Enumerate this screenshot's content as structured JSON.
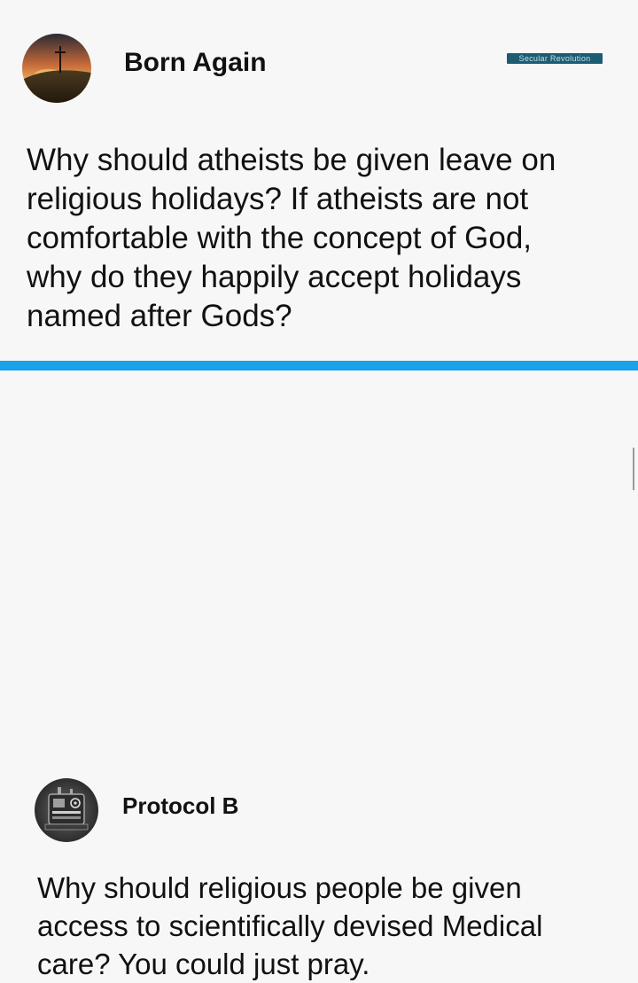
{
  "watermark": {
    "text": "Secular Revolution"
  },
  "colors": {
    "divider": "#1aa3e8",
    "background": "#f7f7f7",
    "watermark_bg": "#1d5b72"
  },
  "posts": [
    {
      "author": "Born Again",
      "avatar": "sunset-cross-on-hill-icon",
      "lines": [
        "Why should atheists be given leave on",
        "religious holidays? If atheists are not",
        "comfortable with the concept of God,",
        "why do they happily accept holidays",
        "named after Gods?"
      ]
    },
    {
      "author": "Protocol B",
      "avatar": "machine-icon",
      "lines": [
        "Why should religious people be given",
        "access to scientifically devised Medical",
        "care? You could just pray."
      ]
    }
  ]
}
